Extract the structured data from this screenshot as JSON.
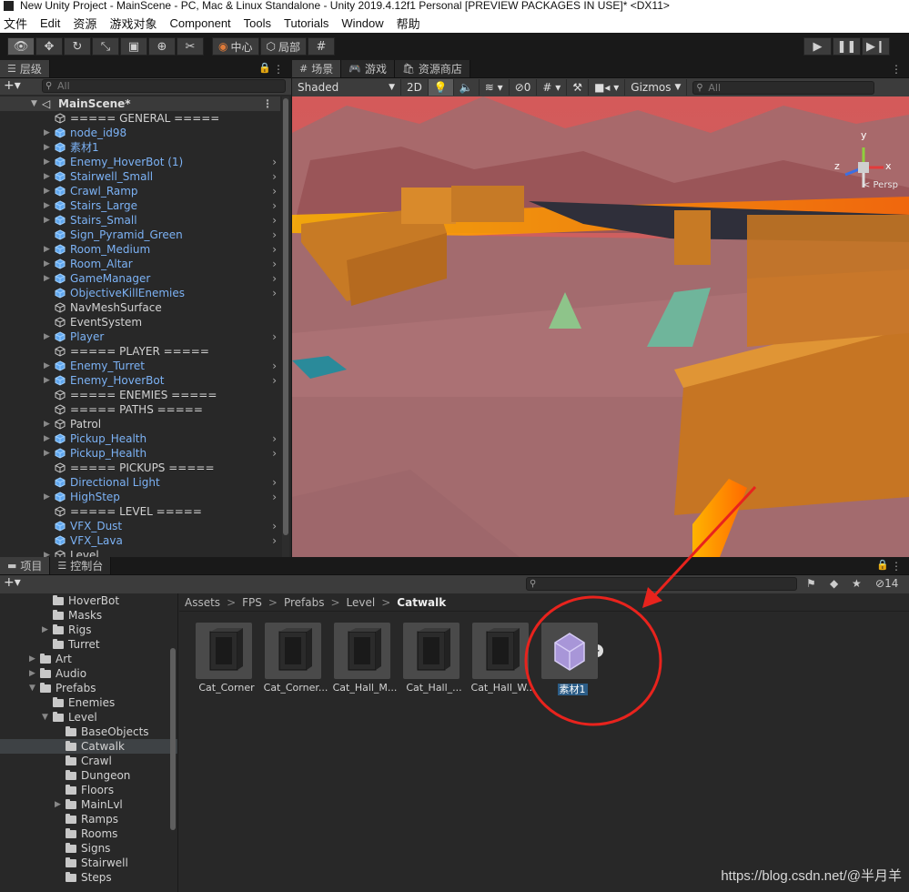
{
  "window": {
    "title": "New Unity Project - MainScene - PC, Mac & Linux Standalone - Unity 2019.4.12f1 Personal [PREVIEW PACKAGES IN USE]* <DX11>"
  },
  "menu": [
    "文件",
    "Edit",
    "资源",
    "游戏对象",
    "Component",
    "Tools",
    "Tutorials",
    "Window",
    "帮助"
  ],
  "toolbar": {
    "pivot_label": "中心",
    "space_label": "局部"
  },
  "hierarchy": {
    "tab_label": "层级",
    "search_placeholder": "All",
    "scene_name": "MainScene*",
    "items": [
      {
        "label": "===== GENERAL =====",
        "type": "plain",
        "arrow": false,
        "chev": false
      },
      {
        "label": "node_id98",
        "type": "prefab",
        "arrow": true,
        "chev": false
      },
      {
        "label": "素材1",
        "type": "prefab",
        "arrow": true,
        "chev": false
      },
      {
        "label": "Enemy_HoverBot (1)",
        "type": "prefab",
        "arrow": true,
        "chev": true
      },
      {
        "label": "Stairwell_Small",
        "type": "prefab",
        "arrow": true,
        "chev": true
      },
      {
        "label": "Crawl_Ramp",
        "type": "prefab",
        "arrow": true,
        "chev": true
      },
      {
        "label": "Stairs_Large",
        "type": "prefab",
        "arrow": true,
        "chev": true
      },
      {
        "label": "Stairs_Small",
        "type": "prefab",
        "arrow": true,
        "chev": true
      },
      {
        "label": "Sign_Pyramid_Green",
        "type": "prefab",
        "arrow": false,
        "chev": true
      },
      {
        "label": "Room_Medium",
        "type": "prefab",
        "arrow": true,
        "chev": true
      },
      {
        "label": "Room_Altar",
        "type": "prefab",
        "arrow": true,
        "chev": true
      },
      {
        "label": "GameManager",
        "type": "prefab",
        "arrow": true,
        "chev": true
      },
      {
        "label": "ObjectiveKillEnemies",
        "type": "prefab",
        "arrow": false,
        "chev": true
      },
      {
        "label": "NavMeshSurface",
        "type": "plain",
        "arrow": false,
        "chev": false
      },
      {
        "label": "EventSystem",
        "type": "plain",
        "arrow": false,
        "chev": false
      },
      {
        "label": "Player",
        "type": "prefab",
        "arrow": true,
        "chev": true
      },
      {
        "label": "===== PLAYER =====",
        "type": "plain",
        "arrow": false,
        "chev": false
      },
      {
        "label": "Enemy_Turret",
        "type": "prefab",
        "arrow": true,
        "chev": true
      },
      {
        "label": "Enemy_HoverBot",
        "type": "prefab",
        "arrow": true,
        "chev": true
      },
      {
        "label": "===== ENEMIES =====",
        "type": "plain",
        "arrow": false,
        "chev": false
      },
      {
        "label": "===== PATHS =====",
        "type": "plain",
        "arrow": false,
        "chev": false
      },
      {
        "label": "Patrol",
        "type": "plain",
        "arrow": true,
        "chev": false
      },
      {
        "label": "Pickup_Health",
        "type": "prefab",
        "arrow": true,
        "chev": true
      },
      {
        "label": "Pickup_Health",
        "type": "prefab",
        "arrow": true,
        "chev": true
      },
      {
        "label": "===== PICKUPS =====",
        "type": "plain",
        "arrow": false,
        "chev": false
      },
      {
        "label": "Directional Light",
        "type": "prefab",
        "arrow": false,
        "chev": true
      },
      {
        "label": "HighStep",
        "type": "prefab",
        "arrow": true,
        "chev": true
      },
      {
        "label": "===== LEVEL =====",
        "type": "plain",
        "arrow": false,
        "chev": false
      },
      {
        "label": "VFX_Dust",
        "type": "prefab",
        "arrow": false,
        "chev": true
      },
      {
        "label": "VFX_Lava",
        "type": "prefab",
        "arrow": false,
        "chev": true
      },
      {
        "label": "Level",
        "type": "plain",
        "arrow": true,
        "chev": false
      }
    ]
  },
  "scene": {
    "tabs": [
      "场景",
      "游戏",
      "资源商店"
    ],
    "shading": "Shaded",
    "mode_2d": "2D",
    "hidden_count": "0",
    "gizmos_label": "Gizmos",
    "search_placeholder": "All",
    "persp_label": "< Persp",
    "axis_y": "y",
    "axis_x": "x",
    "axis_z": "z"
  },
  "project": {
    "tabs": [
      "项目",
      "控制台"
    ],
    "hidden_count": "14",
    "breadcrumb": [
      "Assets",
      "FPS",
      "Prefabs",
      "Level",
      "Catwalk"
    ],
    "tree": [
      {
        "label": "HoverBot",
        "indent": 4,
        "arrow": false,
        "sel": false
      },
      {
        "label": "Masks",
        "indent": 4,
        "arrow": false,
        "sel": false
      },
      {
        "label": "Rigs",
        "indent": 4,
        "arrow": true,
        "sel": false
      },
      {
        "label": "Turret",
        "indent": 4,
        "arrow": false,
        "sel": false
      },
      {
        "label": "Art",
        "indent": 3,
        "arrow": true,
        "sel": false
      },
      {
        "label": "Audio",
        "indent": 3,
        "arrow": true,
        "sel": false
      },
      {
        "label": "Prefabs",
        "indent": 3,
        "arrow": true,
        "open": true,
        "sel": false
      },
      {
        "label": "Enemies",
        "indent": 4,
        "arrow": false,
        "sel": false
      },
      {
        "label": "Level",
        "indent": 4,
        "arrow": true,
        "open": true,
        "sel": false
      },
      {
        "label": "BaseObjects",
        "indent": 5,
        "arrow": false,
        "sel": false
      },
      {
        "label": "Catwalk",
        "indent": 5,
        "arrow": false,
        "sel": true
      },
      {
        "label": "Crawl",
        "indent": 5,
        "arrow": false,
        "sel": false
      },
      {
        "label": "Dungeon",
        "indent": 5,
        "arrow": false,
        "sel": false
      },
      {
        "label": "Floors",
        "indent": 5,
        "arrow": false,
        "sel": false
      },
      {
        "label": "MainLvl",
        "indent": 5,
        "arrow": true,
        "sel": false
      },
      {
        "label": "Ramps",
        "indent": 5,
        "arrow": false,
        "sel": false
      },
      {
        "label": "Rooms",
        "indent": 5,
        "arrow": false,
        "sel": false
      },
      {
        "label": "Signs",
        "indent": 5,
        "arrow": false,
        "sel": false
      },
      {
        "label": "Stairwell",
        "indent": 5,
        "arrow": false,
        "sel": false
      },
      {
        "label": "Steps",
        "indent": 5,
        "arrow": false,
        "sel": false
      }
    ],
    "assets": [
      {
        "label": "Cat_Corner",
        "kind": "corner"
      },
      {
        "label": "Cat_Corner...",
        "kind": "corner2"
      },
      {
        "label": "Cat_Hall_M...",
        "kind": "hall"
      },
      {
        "label": "Cat_Hall_...",
        "kind": "hall2"
      },
      {
        "label": "Cat_Hall_W...",
        "kind": "hall3"
      },
      {
        "label": "素材1",
        "kind": "model",
        "selected": true
      }
    ]
  },
  "watermark": "https://blog.csdn.net/@半月羊",
  "colors": {
    "accent_annotation": "#e8231d",
    "prefab_text": "#7cb2f5",
    "selection": "#2c5d87"
  }
}
